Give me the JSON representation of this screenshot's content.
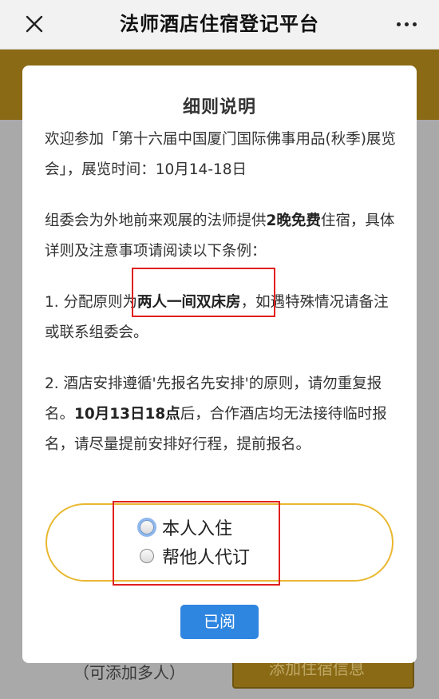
{
  "nav": {
    "title": "法师酒店住宿登记平台",
    "close_icon": "close-icon",
    "more_icon": "more-dots-icon"
  },
  "background": {
    "add_hint": "（可添加多人）",
    "add_button_label": "添加住宿信息"
  },
  "modal": {
    "title": "细则说明",
    "p1": "欢迎参加「第十六届中国厦门国际佛事用品(秋季)展览会」，展览时间：10月14-18日",
    "p2_before": "组委会为外地前来观展的法师提供",
    "p2_bold": "2晚免费",
    "p2_after": "住宿，具体详则及注意事项请阅读以下条例：",
    "p3_before": "1. 分配原则为",
    "p3_bold": "两人一间双床房",
    "p3_after": "，如遇特殊情况请备注或联系组委会。",
    "p4_before": "2. 酒店安排遵循'先报名先安排'的原则，请勿重复报名。",
    "p4_bold": "10月13日18点",
    "p4_after": "后，合作酒店均无法接待临时报名，请尽量提前安排好行程，提前报名。",
    "options": [
      "本人入住",
      "帮他人代订"
    ],
    "confirm_label": "已阅"
  },
  "colors": {
    "accent": "#2f86e0",
    "gold": "#e9b830",
    "highlight_red": "#e0201e"
  }
}
